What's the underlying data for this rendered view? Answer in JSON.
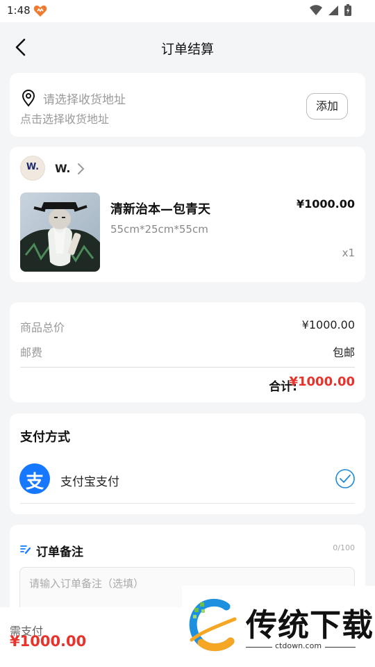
{
  "status_bar": {
    "time": "1:48",
    "app_icon": "heart-app-icon",
    "icons": [
      "wifi-icon",
      "signal-icon",
      "battery-icon"
    ]
  },
  "header": {
    "title": "订单结算",
    "back_icon": "chevron-left-icon"
  },
  "address": {
    "title": "请选择收货地址",
    "subtitle": "点击选择收货地址",
    "add_label": "添加",
    "icon": "location-pin-icon"
  },
  "shop": {
    "avatar_text": "W.",
    "name": "W."
  },
  "product": {
    "name": "清新治本—包青天",
    "spec": "55cm*25cm*55cm",
    "price": "¥1000.00",
    "quantity": "x1"
  },
  "summary": {
    "rows": [
      {
        "label": "商品总价",
        "value": "¥1000.00"
      },
      {
        "label": "邮费",
        "value": "包邮"
      }
    ],
    "total_label": "合计:",
    "total_value": "¥1000.00"
  },
  "payment": {
    "heading": "支付方式",
    "method_label": "支付宝支付",
    "method_glyph": "支",
    "selected": true,
    "accent": "#1677ff"
  },
  "note": {
    "heading": "订单备注",
    "count": "0/100",
    "placeholder": "请输入订单备注（选填）"
  },
  "bottom_bar": {
    "label": "需支付",
    "amount": "¥1000.00"
  },
  "watermark": {
    "text": "传统下载",
    "url": "ctdown.com"
  },
  "colors": {
    "price_red": "#e8332c",
    "alipay_blue": "#1677ff",
    "background": "#f4f5f7"
  }
}
